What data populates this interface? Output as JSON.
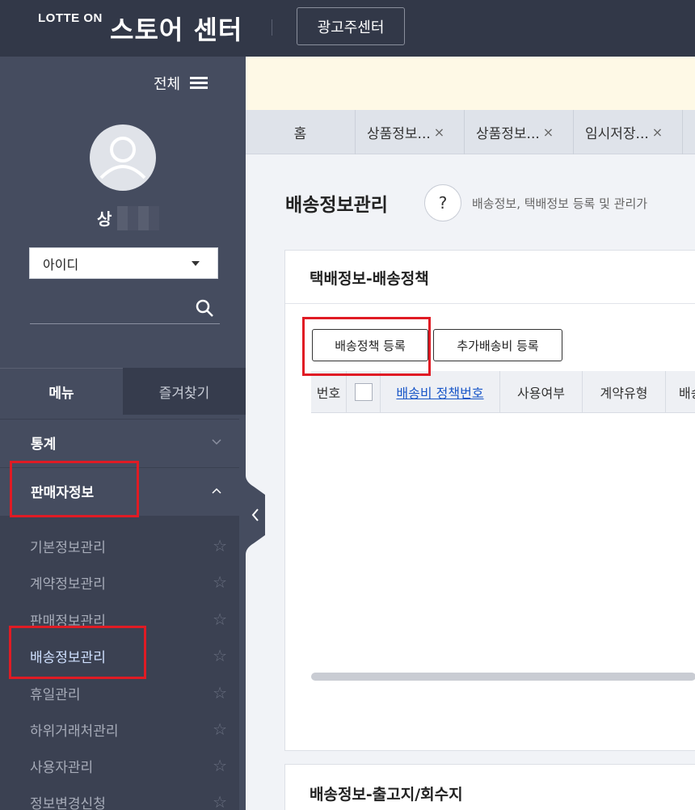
{
  "header": {
    "brand": "LOTTE ON",
    "title": "스토어 센터",
    "ad_center_button": "광고주센터"
  },
  "sidebar": {
    "all_label": "전체",
    "user_name": "상",
    "id_select_value": "아이디",
    "tabs": [
      "메뉴",
      "즐겨찾기"
    ],
    "categories": [
      {
        "label": "통계",
        "expanded": false
      },
      {
        "label": "판매자정보",
        "expanded": true
      }
    ],
    "submenu": [
      {
        "label": "기본정보관리"
      },
      {
        "label": "계약정보관리"
      },
      {
        "label": "판매정보관리"
      },
      {
        "label": "배송정보관리",
        "active": true
      },
      {
        "label": "휴일관리"
      },
      {
        "label": "하위거래처관리"
      },
      {
        "label": "사용자관리"
      },
      {
        "label": "정보변경신청"
      }
    ]
  },
  "page_tabs": [
    {
      "label": "홈"
    },
    {
      "label": "상품정보...",
      "close": "×"
    },
    {
      "label": "상품정보...",
      "close": "×"
    },
    {
      "label": "임시저장...",
      "close": "×"
    }
  ],
  "page": {
    "title": "배송정보관리",
    "help_icon": "?",
    "description": "배송정보, 택배정보 등록 및 관리가"
  },
  "panel1": {
    "title": "택배정보-배송정책",
    "buttons": [
      "배송정책 등록",
      "추가배송비 등록"
    ],
    "columns": [
      "번호",
      "",
      "배송비 정책번호",
      "사용여부",
      "계약유형",
      "배송"
    ]
  },
  "panel2": {
    "title": "배송정보-출고지/회수지"
  },
  "colors": {
    "topbar": "#323848",
    "sidebar": "#454c5f",
    "highlight": "#e01b24",
    "link": "#1a57c8"
  }
}
